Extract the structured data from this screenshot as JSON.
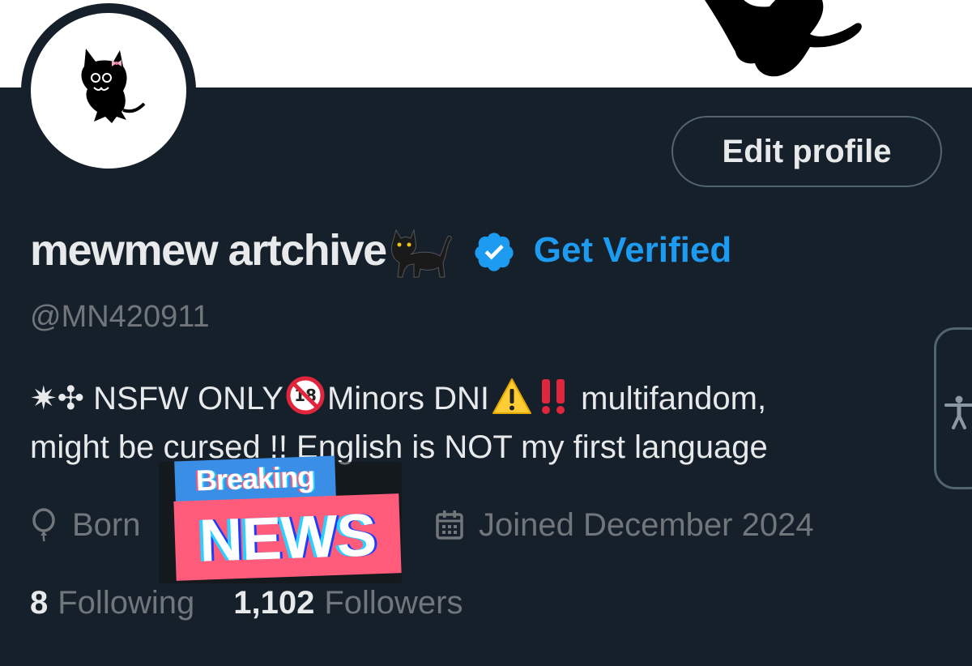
{
  "colors": {
    "background": "#15202b",
    "text_primary": "#e7e9ea",
    "text_secondary": "#71767b",
    "accent": "#1d9bf0",
    "banner": "#ffffff",
    "sticker_blue": "#3a8ee6",
    "sticker_pink": "#ff5c7c"
  },
  "header": {
    "banner_icon": "black-cat-silhouette-icon",
    "avatar_icon": "black-cat-avatar-icon"
  },
  "actions": {
    "edit_profile_label": "Edit profile"
  },
  "profile": {
    "display_name": "mewmew artchive",
    "name_emoji_icon": "black-cat-emoji-icon",
    "verified_icon": "verified-badge-icon",
    "get_verified_label": "Get Verified",
    "handle": "@MN420911",
    "bio": {
      "line1_prefix": "✷✣ NSFW ONLY",
      "line1_no_minors_icon": "no-under-18-icon",
      "line1_middle": "Minors DNI",
      "line1_warning_icon": "warning-icon",
      "line1_exclaim_icon": "double-exclamation-icon",
      "line1_suffix": "multifandom,",
      "line2": "might be cursed !! English is NOT my first language"
    },
    "born_text": "Born",
    "born_icon": "balloon-icon",
    "joined_text": "Joined December 2024",
    "joined_icon": "calendar-icon",
    "following_count": "8",
    "following_label": "Following",
    "followers_count": "1,102",
    "followers_label": "Followers"
  },
  "sticker": {
    "line1": "Breaking",
    "line2": "NEWS"
  },
  "accessibility": {
    "icon": "accessibility-icon"
  }
}
